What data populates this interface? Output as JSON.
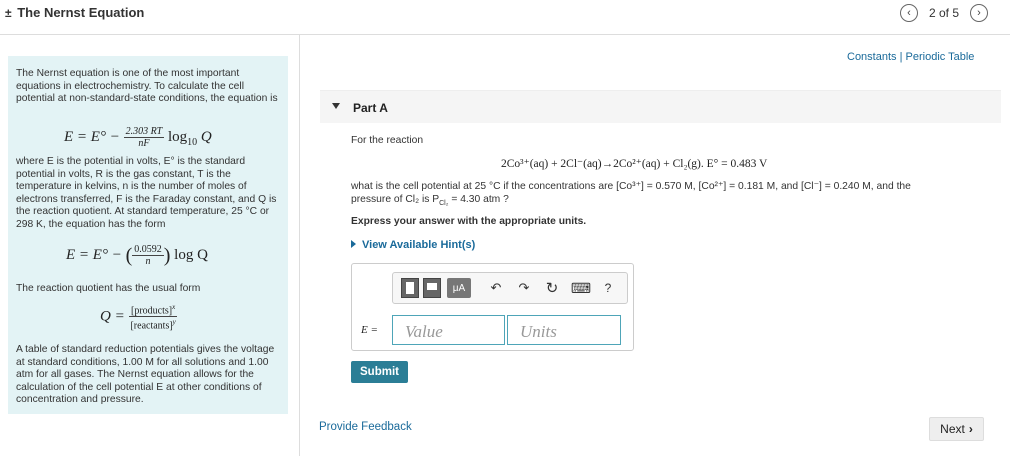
{
  "header": {
    "title_prefix": "±",
    "title": "The Nernst Equation",
    "pager_text": "2 of 5",
    "prev_icon": "‹",
    "next_icon": "›"
  },
  "info": {
    "intro": "The Nernst equation is one of the most important equations in electrochemistry. To calculate the cell potential at non-standard-state conditions, the equation is",
    "eq1_lhs": "E = E° −",
    "eq1_num": "2.303 RT",
    "eq1_den": "nF",
    "eq1_rhs": "log",
    "eq1_sub": "10",
    "eq1_q": "Q",
    "where_text": "where E is the potential in volts, E° is the standard potential in volts, R is the gas constant, T is the temperature in kelvins, n is the number of moles of electrons transferred, F is the Faraday constant, and Q is the reaction quotient. At standard temperature, 25 °C or 298 K, the equation has the form",
    "eq2_lhs": "E = E° −",
    "eq2_num": "0.0592",
    "eq2_den": "n",
    "eq2_rhs": "log Q",
    "quotient_text": "The reaction quotient has the usual form",
    "eq3_lhs": "Q =",
    "eq3_num": "[products]",
    "eq3_num_exp": "x",
    "eq3_den": "[reactants]",
    "eq3_den_exp": "y",
    "table_text": "A table of standard reduction potentials gives the voltage at standard conditions, 1.00 M for all solutions and 1.00 atm for all gases. The Nernst equation allows for the calculation of the cell potential E at other conditions of concentration and pressure."
  },
  "links": {
    "constants": "Constants",
    "separator": " | ",
    "periodic_table": "Periodic Table"
  },
  "part": {
    "label": "Part A"
  },
  "question": {
    "for_reaction": "For the reaction",
    "reaction": "2Co³⁺(aq) + 2Cl⁻(aq)→2Co²⁺(aq) + Cl₂(g).   E° = 0.483 V",
    "prompt_line1": "what is the cell potential at 25 °C if the concentrations are [Co³⁺] = 0.570 M, [Co²⁺] = 0.181 M, and [Cl⁻] = 0.240 M, and the",
    "prompt_line2": "pressure of Cl₂ is P",
    "prompt_sub": "Cl₂",
    "prompt_line2_end": " = 4.30 atm ?",
    "express": "Express your answer with the appropriate units.",
    "hint_link": "View Available Hint(s)"
  },
  "answer": {
    "toolbar_mu": "μA",
    "undo_icon": "↶",
    "redo_icon": "↷",
    "reset_icon": "↻",
    "keyboard_icon": "⌨",
    "help_icon": "?",
    "e_label": "E =",
    "value_placeholder": "Value",
    "units_placeholder": "Units"
  },
  "buttons": {
    "submit": "Submit",
    "feedback": "Provide Feedback",
    "next": "Next",
    "next_icon": "›"
  }
}
